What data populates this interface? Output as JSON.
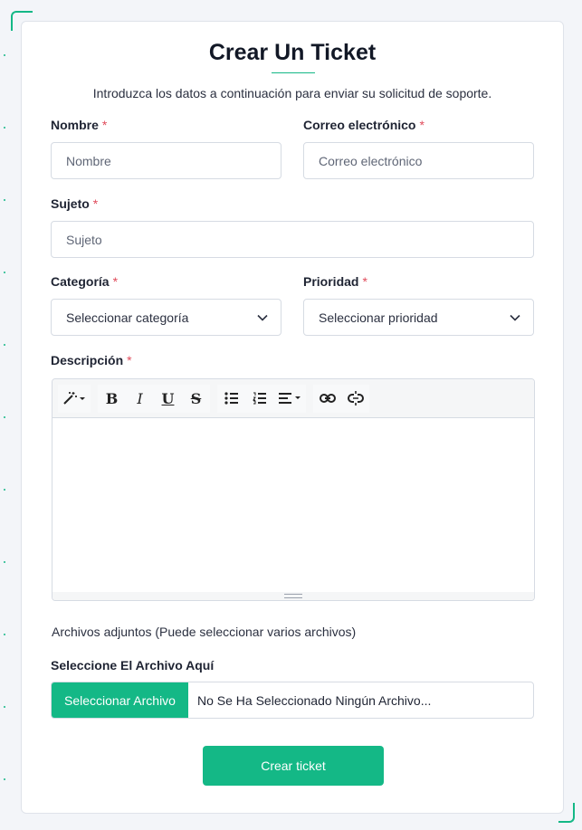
{
  "form": {
    "title": "Crear Un Ticket",
    "subtitle": "Introduzca los datos a continuación para enviar su solicitud de soporte.",
    "required_mark": "*",
    "name": {
      "label": "Nombre",
      "placeholder": "Nombre"
    },
    "email": {
      "label": "Correo electrónico",
      "placeholder": "Correo electrónico"
    },
    "subject": {
      "label": "Sujeto",
      "placeholder": "Sujeto"
    },
    "category": {
      "label": "Categoría",
      "value": "Seleccionar categoría"
    },
    "priority": {
      "label": "Prioridad",
      "value": "Seleccionar prioridad"
    },
    "description": {
      "label": "Descripción"
    },
    "attachments": {
      "note": "Archivos adjuntos (Puede seleccionar varios archivos)",
      "label": "Seleccione El Archivo Aquí",
      "button": "Seleccionar Archivo",
      "status": "No Se Ha Seleccionado Ningún Archivo..."
    },
    "submit_label": "Crear ticket"
  },
  "toolbar_icons": [
    "magic-wand-icon",
    "bold-icon",
    "italic-icon",
    "underline-icon",
    "strikethrough-icon",
    "bullet-list-icon",
    "numbered-list-icon",
    "align-icon",
    "link-icon",
    "unlink-icon"
  ],
  "colors": {
    "accent": "#14b886",
    "required": "#e04b5b",
    "border": "#d6dbe3"
  }
}
